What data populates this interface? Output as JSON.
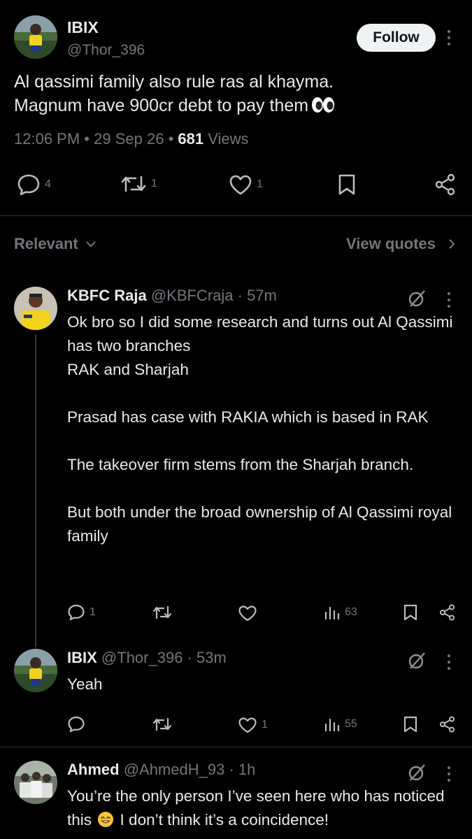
{
  "tweet": {
    "name": "IBIX",
    "handle": "@Thor_396",
    "follow_label": "Follow",
    "text": "Al qassimi family also rule ras al khayma.\nMagnum have 900cr debt to pay them",
    "emoji": "eyes",
    "time": "12:06 PM",
    "sep1": "•",
    "date": "29 Sep 26",
    "sep2": "•",
    "views_count": "681",
    "views_label": "Views",
    "replies": "4",
    "reposts": "1",
    "likes": "1"
  },
  "sort": {
    "relevant_label": "Relevant",
    "view_quotes_label": "View quotes"
  },
  "replies": [
    {
      "name": "KBFC Raja",
      "handle": "@KBFCraja",
      "time": "· 57m",
      "body": "Ok bro so I did some research and turns out Al Qassimi has two branches\nRAK and Sharjah\n\nPrasad has case with RAKIA which is based in RAK\n\nThe takeover firm stems from the Sharjah branch.\n\nBut both under the broad ownership of Al Qassimi royal family",
      "replies": "1",
      "reposts": "",
      "likes": "",
      "views": "63"
    },
    {
      "name": "IBIX",
      "handle": "@Thor_396",
      "time": "· 53m",
      "body": "Yeah",
      "replies": "",
      "reposts": "",
      "likes": "1",
      "views": "55"
    },
    {
      "name": "Ahmed",
      "handle": "@AhmedH_93",
      "time": "· 1h",
      "body_before": "You’re the only person I’ve seen here who has noticed this",
      "body_after": "I don’t think it’s a coincidence!"
    }
  ],
  "icons": {
    "reply": "reply-bubble-icon",
    "repost": "repost-icon",
    "like": "heart-icon",
    "bookmark": "bookmark-icon",
    "share": "share-icon",
    "views": "views-bar-icon",
    "grok": "grok-icon",
    "more": "more-vertical-icon"
  },
  "colors": {
    "background": "#000000",
    "text": "#e7e9ea",
    "muted": "#71767b",
    "divider": "#2f3336",
    "follow_bg": "#eff3f4"
  }
}
